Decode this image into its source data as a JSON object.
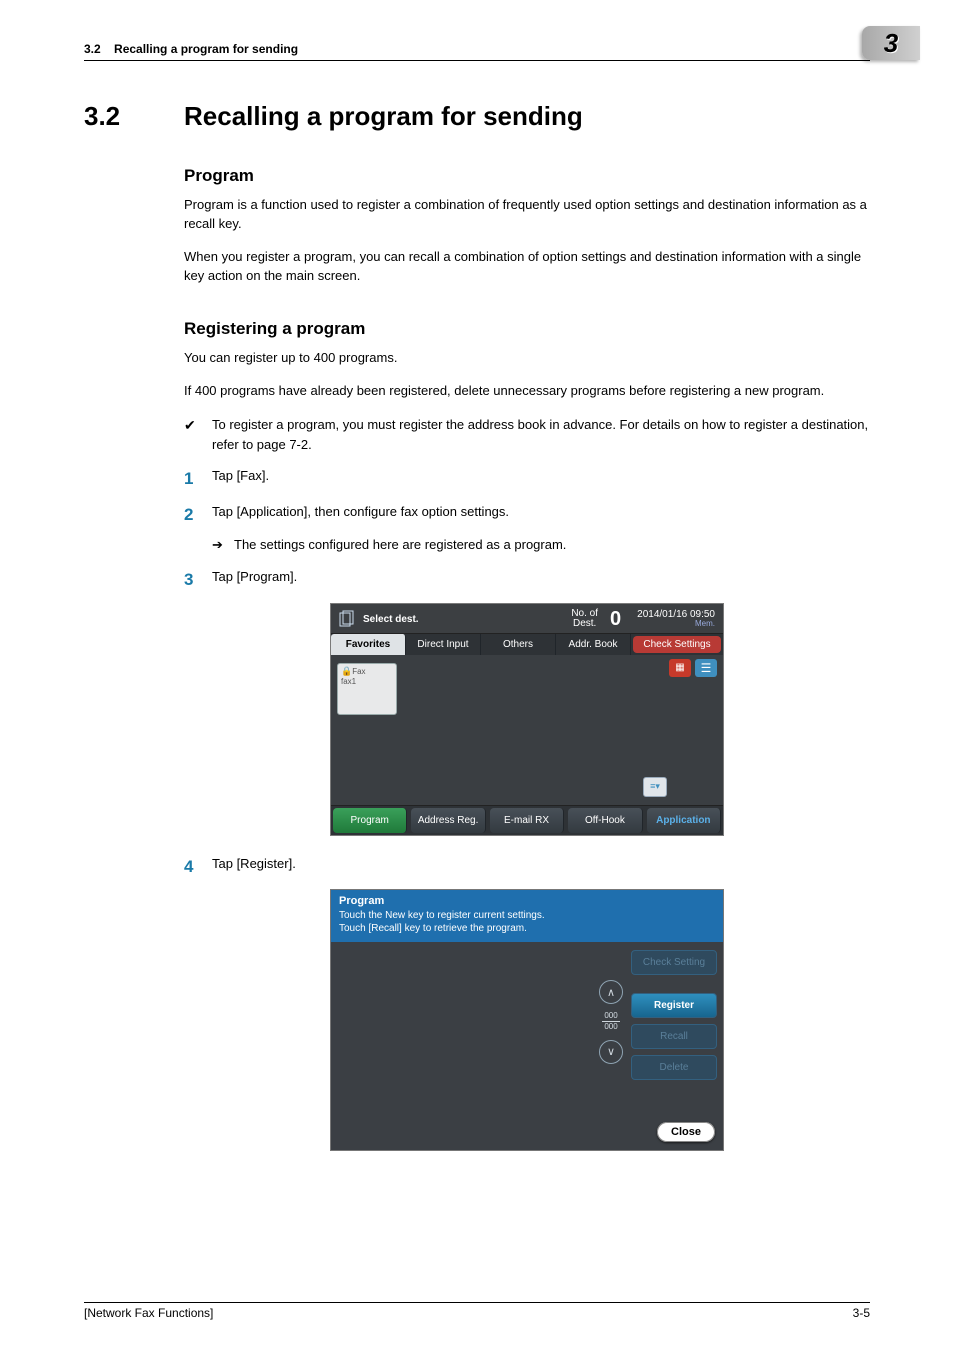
{
  "header": {
    "running_head_section": "3.2",
    "running_head_title": "Recalling a program for sending",
    "chapter_tab": "3"
  },
  "section": {
    "number": "3.2",
    "title": "Recalling a program for sending"
  },
  "h3_program": "Program",
  "p_program_1": "Program is a function used to register a combination of frequently used option settings and destination information as a recall key.",
  "p_program_2": "When you register a program, you can recall a combination of option settings and destination information with a single key action on the main screen.",
  "h3_register": "Registering a program",
  "p_register_1": "You can register up to 400 programs.",
  "p_register_2": "If 400 programs have already been registered, delete unnecessary programs before registering a new program.",
  "check_note": "To register a program, you must register the address book in advance. For details on how to register a destination, refer to page 7-2.",
  "steps": {
    "s1": {
      "num": "1",
      "text": "Tap [Fax]."
    },
    "s2": {
      "num": "2",
      "text": "Tap [Application], then configure fax option settings."
    },
    "s2_sub": "The settings configured here are registered as a program.",
    "s3": {
      "num": "3",
      "text": "Tap [Program]."
    },
    "s4": {
      "num": "4",
      "text": "Tap [Register]."
    }
  },
  "screenshot1": {
    "select_dest": "Select dest.",
    "no_of_dest_label": "No. of\nDest.",
    "no_of_dest_value": "0",
    "timestamp": "2014/01/16 09:50",
    "memory": "Mem.",
    "tabs": {
      "favorites": "Favorites",
      "direct_input": "Direct Input",
      "others": "Others",
      "addr_book": "Addr. Book"
    },
    "check_settings": "Check Settings",
    "fax_tile_type": "Fax",
    "fax_tile_name": "fax1",
    "bottom": {
      "program": "Program",
      "address_reg": "Address Reg.",
      "email_rx": "E-mail RX",
      "off_hook": "Off-Hook",
      "application": "Application"
    }
  },
  "screenshot2": {
    "title": "Program",
    "line1": "Touch the New key to register current settings.",
    "line2": "Touch [Recall] key to retrieve the program.",
    "check_setting": "Check Setting",
    "register": "Register",
    "recall": "Recall",
    "delete": "Delete",
    "counter_top": "000",
    "counter_bottom": "000",
    "close": "Close"
  },
  "footer": {
    "left": "[Network Fax Functions]",
    "right": "3-5"
  }
}
